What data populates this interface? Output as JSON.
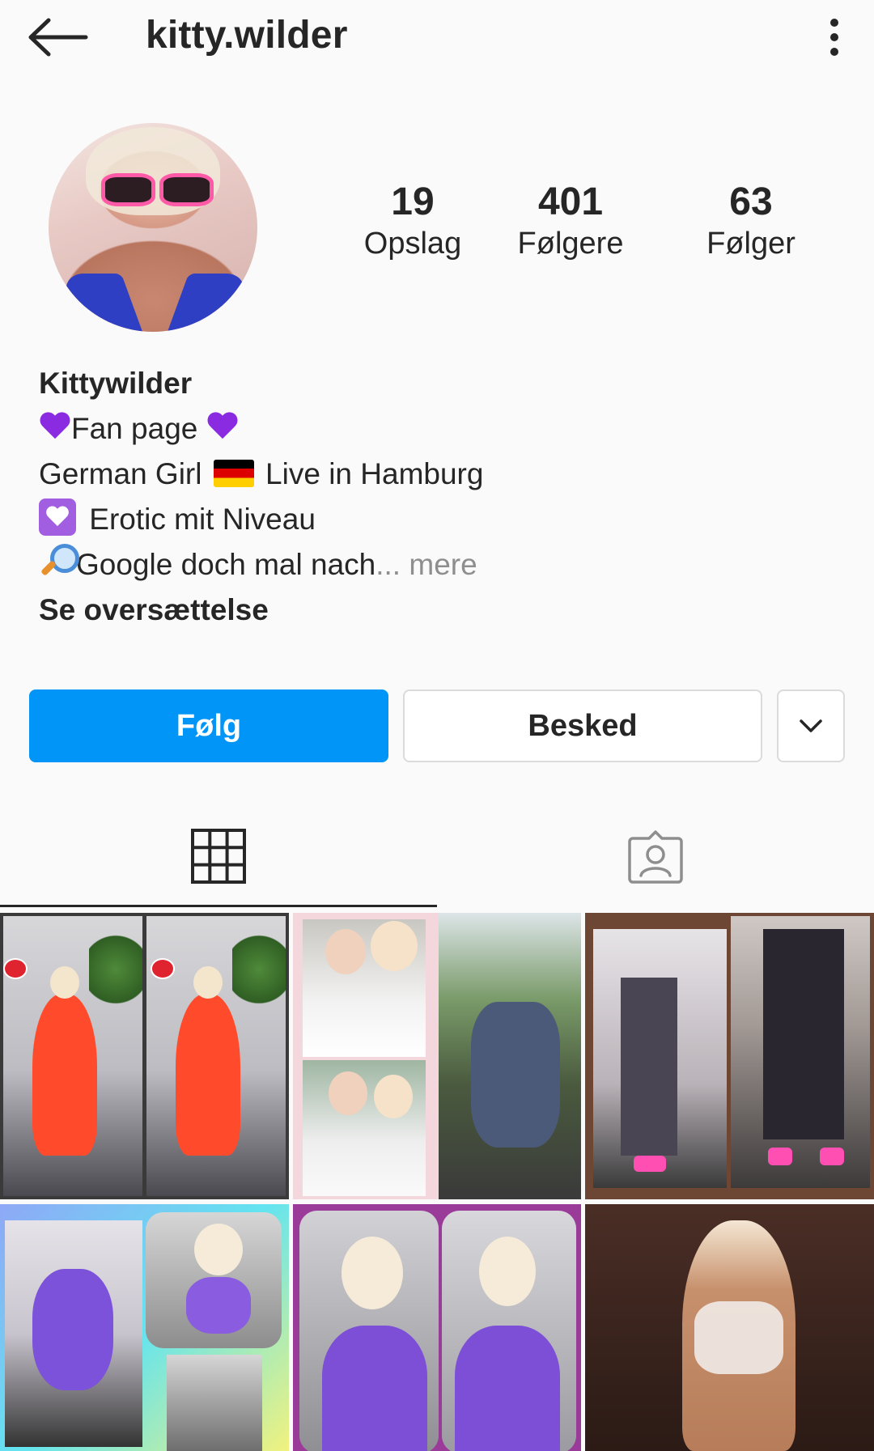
{
  "header": {
    "username": "kitty.wilder",
    "back_icon": "arrow-left-icon",
    "more_icon": "vertical-dots-icon"
  },
  "profile": {
    "avatar_icon": "profile-photo",
    "stats": [
      {
        "value": "19",
        "label": "Opslag"
      },
      {
        "value": "401",
        "label": "Følgere"
      },
      {
        "value": "63",
        "label": "Følger"
      }
    ]
  },
  "bio": {
    "name": "Kittywilder",
    "line1": "Fan page ",
    "line2_a": "German Girl ",
    "line2_b": " Live in Hamburg",
    "line3": " Erotic mit Niveau",
    "line4": "Google doch mal  nach",
    "more": "... mere",
    "translate": "Se oversættelse"
  },
  "actions": {
    "follow": "Følg",
    "message": "Besked",
    "suggest_icon": "chevron-down-icon"
  },
  "tabs": [
    {
      "name": "posts",
      "icon": "grid-icon",
      "active": true
    },
    {
      "name": "tagged",
      "icon": "tagged-person-icon",
      "active": false
    }
  ],
  "colors": {
    "accent": "#0095f6",
    "text": "#262626",
    "muted": "#8e8e8e",
    "border": "#dbdbdb",
    "background": "#fafafa"
  }
}
